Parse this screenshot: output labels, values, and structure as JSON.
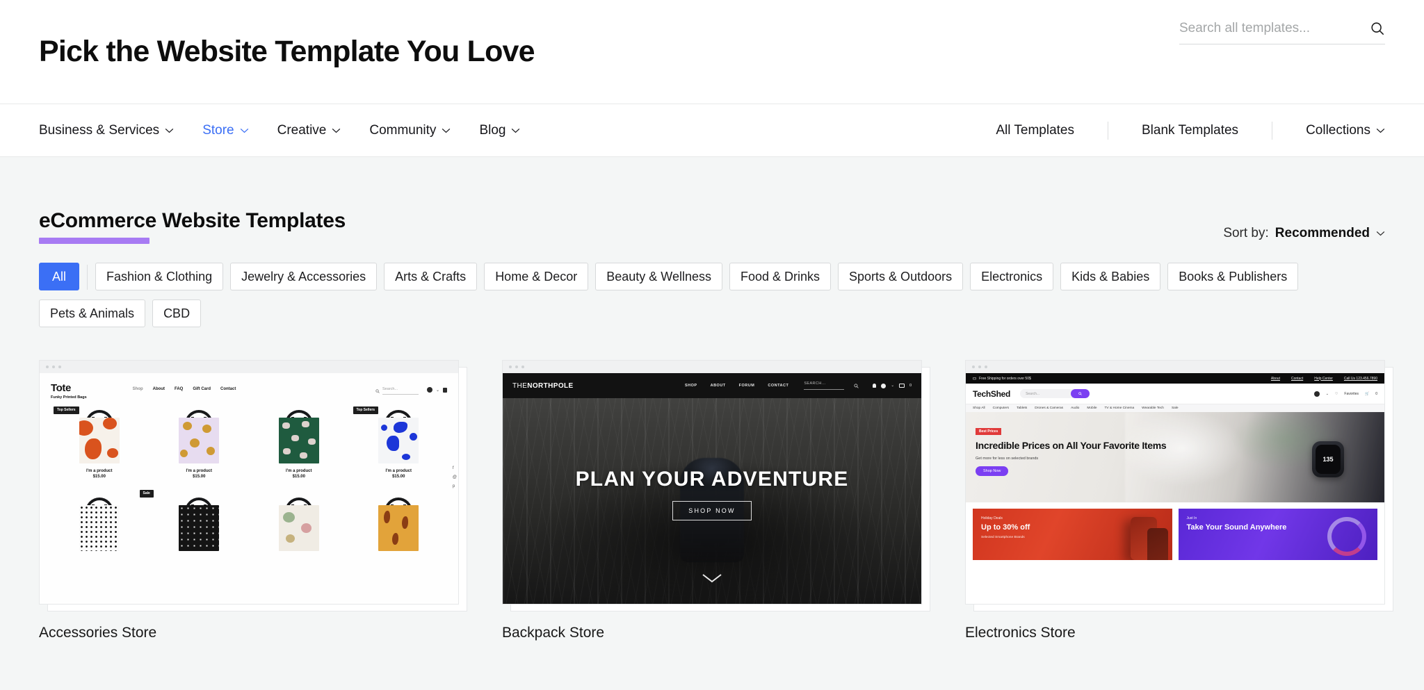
{
  "header": {
    "title": "Pick the Website Template You Love",
    "search": {
      "placeholder": "Search all templates...",
      "value": "",
      "icon": "search-icon"
    }
  },
  "nav": {
    "left": [
      {
        "label": "Business & Services",
        "has_chevron": true,
        "active": false
      },
      {
        "label": "Store",
        "has_chevron": true,
        "active": true
      },
      {
        "label": "Creative",
        "has_chevron": true,
        "active": false
      },
      {
        "label": "Community",
        "has_chevron": true,
        "active": false
      },
      {
        "label": "Blog",
        "has_chevron": true,
        "active": false
      }
    ],
    "right": [
      {
        "label": "All Templates",
        "has_chevron": false
      },
      {
        "label": "Blank Templates",
        "has_chevron": false
      },
      {
        "label": "Collections",
        "has_chevron": true
      }
    ],
    "active_color": "#3b6ff5"
  },
  "section": {
    "title": "eCommerce Website Templates",
    "underline_color": "#a77bf3",
    "sort": {
      "label": "Sort by:",
      "value": "Recommended",
      "icon": "chevron-down-icon"
    }
  },
  "filters": {
    "active": "All",
    "chips": [
      "All",
      "Fashion & Clothing",
      "Jewelry & Accessories",
      "Arts & Crafts",
      "Home & Decor",
      "Beauty & Wellness",
      "Food & Drinks",
      "Sports & Outdoors",
      "Electronics",
      "Kids & Babies",
      "Books & Publishers",
      "Pets & Animals",
      "CBD"
    ],
    "active_color": "#3b6ff5"
  },
  "cards": [
    {
      "title": "Accessories Store",
      "preview": {
        "brand": "Tote",
        "tagline": "Funky Printed Bags",
        "nav": [
          "Shop",
          "About",
          "FAQ",
          "Gift Card",
          "Contact"
        ],
        "search_placeholder": "Search...",
        "badges": [
          "Top Sellers",
          "Sale"
        ],
        "product_name": "I'm a product",
        "product_price": "$15.00",
        "social": [
          "f",
          "@",
          "p"
        ]
      }
    },
    {
      "title": "Backpack Store",
      "preview": {
        "brand_thin": "THE",
        "brand_bold": "NORTHPOLE",
        "nav": [
          "SHOP",
          "ABOUT",
          "FORUM",
          "CONTACT"
        ],
        "search_placeholder": "SEARCH...",
        "cart_count": "0",
        "hero_title": "PLAN YOUR ADVENTURE",
        "hero_button": "SHOP NOW"
      }
    },
    {
      "title": "Electronics Store",
      "preview": {
        "announcement": "Free Shipping for orders over 50$",
        "top_links": [
          "About",
          "Contact",
          "Help Center",
          "Call Us 123.456.7890"
        ],
        "brand": "TechShed",
        "search_placeholder": "Search...",
        "favorites_label": "Favorites",
        "cart_count": "0",
        "subnav": [
          "Shop All",
          "Computers",
          "Tablets",
          "Drones & Cameras",
          "Audio",
          "Mobile",
          "TV & Home Cinema",
          "Wearable Tech",
          "Sale"
        ],
        "hero_badge": "Best Prices",
        "hero_title": "Incredible Prices on All Your Favorite Items",
        "hero_sub": "Get more for less on selected brands",
        "hero_cta": "Shop Now",
        "watch_value": "135",
        "promos": [
          {
            "kicker": "Holiday Deals",
            "title": "Up to 30% off",
            "sub": "Selected Smartphone Brands",
            "color": "#d1361f"
          },
          {
            "kicker": "Just In",
            "title": "Take Your Sound Anywhere",
            "sub": "",
            "color": "#5a28d6"
          }
        ]
      }
    }
  ]
}
